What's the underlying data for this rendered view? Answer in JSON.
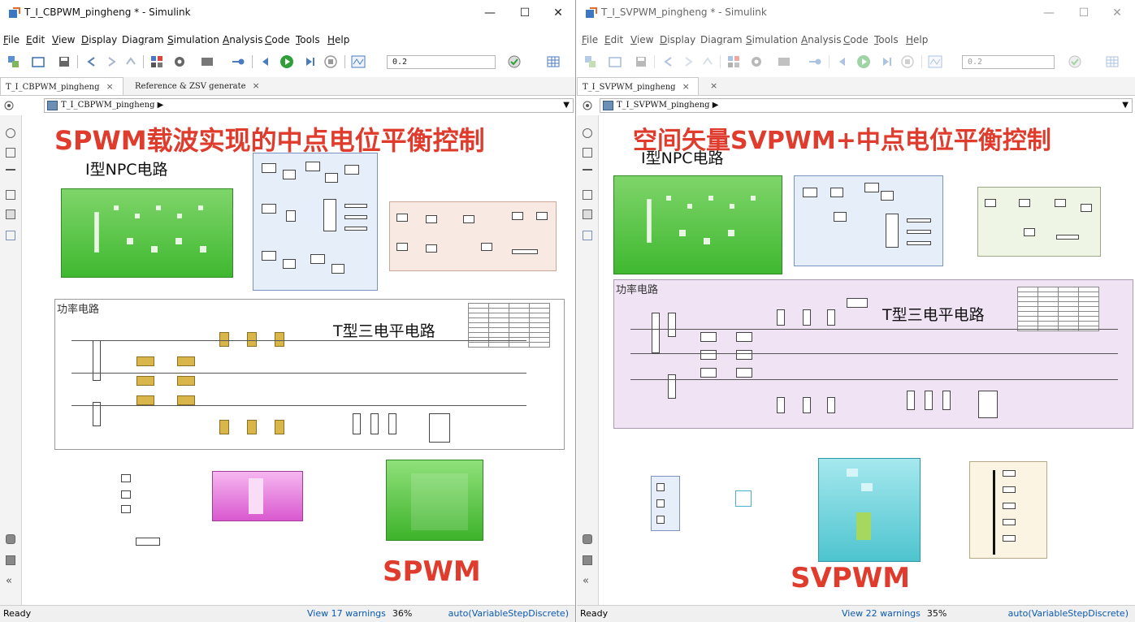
{
  "left": {
    "title": "T_I_CBPWM_pingheng * - Simulink",
    "menu": [
      {
        "text": "File",
        "key": "F"
      },
      {
        "text": "Edit",
        "key": "E"
      },
      {
        "text": "View",
        "key": "V"
      },
      {
        "text": "Display",
        "key": "D"
      },
      {
        "text": "Diagram",
        "key": "g"
      },
      {
        "text": "Simulation",
        "key": "S"
      },
      {
        "text": "Analysis",
        "key": "A"
      },
      {
        "text": "Code",
        "key": "C"
      },
      {
        "text": "Tools",
        "key": "T"
      },
      {
        "text": "Help",
        "key": "H"
      }
    ],
    "stop_time": "0.2",
    "tabs": [
      {
        "label": "T_I_CBPWM_pingheng",
        "close": "×"
      },
      {
        "label": "Reference & ZSV generate",
        "close": "×"
      }
    ],
    "breadcrumb": "T_I_CBPWM_pingheng ▶",
    "heading": "SPWM载波实现的中点电位平衡控制",
    "npc_label": "I型NPC电路",
    "power_label": "功率电路",
    "t3_label": "T型三电平电路",
    "bottom_label": "SPWM",
    "status": {
      "ready": "Ready",
      "warnings": "View 17 warnings",
      "zoom": "36%",
      "solver": "auto(VariableStepDiscrete)"
    }
  },
  "right": {
    "title": "T_I_SVPWM_pingheng * - Simulink",
    "menu": [
      {
        "text": "File",
        "key": "F"
      },
      {
        "text": "Edit",
        "key": "E"
      },
      {
        "text": "View",
        "key": "V"
      },
      {
        "text": "Display",
        "key": "D"
      },
      {
        "text": "Diagram",
        "key": "g"
      },
      {
        "text": "Simulation",
        "key": "S"
      },
      {
        "text": "Analysis",
        "key": "A"
      },
      {
        "text": "Code",
        "key": "C"
      },
      {
        "text": "Tools",
        "key": "T"
      },
      {
        "text": "Help",
        "key": "H"
      }
    ],
    "stop_time": "0.2",
    "tabs": [
      {
        "label": "T_I_SVPWM_pingheng",
        "close": "×"
      },
      {
        "label": "",
        "close": "×"
      }
    ],
    "breadcrumb": "T_I_SVPWM_pingheng ▶",
    "heading": "空间矢量SVPWM+中点电位平衡控制",
    "npc_label": "I型NPC电路",
    "power_label": "功率电路",
    "t3_label": "T型三电平电路",
    "bottom_label": "SVPWM",
    "status": {
      "ready": "Ready",
      "warnings": "View 22 warnings",
      "zoom": "35%",
      "solver": "auto(VariableStepDiscrete)"
    }
  },
  "window_controls": {
    "minimize": "—",
    "maximize": "☐",
    "close": "✕"
  },
  "colors": {
    "heading_red": "#e03c2e",
    "npc_green": "#59c94a",
    "blue_panel": "#e6eefa",
    "peach_panel": "#f8e9e2",
    "power_left_bg": "#ffffff",
    "power_right_bg": "#f0e4f4",
    "magenta_block": "#e98ee0",
    "teal_block": "#7fd8e0",
    "cream_panel": "#fbf4e2",
    "gold_block": "#d8b64a",
    "link_blue": "#0a58b0"
  },
  "icons": {
    "left_rail": [
      "zoom-in-icon",
      "fit-view-icon",
      "arrow-right-icon",
      "annotation-icon",
      "image-icon",
      "box-icon",
      "camera-icon",
      "explorer-icon",
      "collapse-icon"
    ],
    "toolbar": [
      "library-icon",
      "new-icon",
      "save-icon",
      "back-icon",
      "forward-icon",
      "up-icon",
      "grid-icon",
      "gear-icon",
      "display-icon",
      "signal-icon",
      "step-back-icon",
      "run-icon",
      "step-forward-icon",
      "stop-icon",
      "scope-icon",
      "check-icon",
      "table-icon"
    ]
  }
}
